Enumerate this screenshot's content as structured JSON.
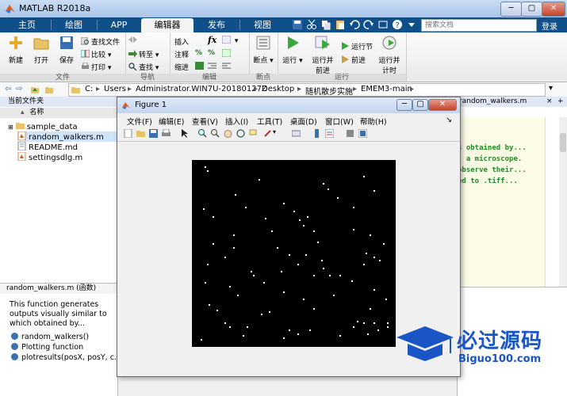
{
  "window": {
    "title": "MATLAB R2018a",
    "min": "─",
    "max": "▢",
    "close": "✕"
  },
  "tabs": [
    "主页",
    "绘图",
    "APP",
    "编辑器",
    "发布",
    "视图"
  ],
  "active_tab": "编辑器",
  "search_placeholder": "搜索文档",
  "login": "登录",
  "ribbon": {
    "file": {
      "label": "文件",
      "new": "新建",
      "open": "打开",
      "save": "保存",
      "find_files": "查找文件",
      "compare": "比较",
      "print": "打印"
    },
    "nav": {
      "label": "导航",
      "goto": "转至",
      "find": "查找"
    },
    "edit": {
      "label": "编辑",
      "insert": "插入",
      "comment": "注释",
      "indent": "缩进",
      "fx": "fx"
    },
    "breakpoints": {
      "label": "断点",
      "bp": "断点"
    },
    "run": {
      "label": "运行",
      "run": "运行",
      "run_advance_1": "运行并",
      "run_advance_2": "前进",
      "run_section": "运行节",
      "advance": "前进",
      "run_time_1": "运行并",
      "run_time_2": "计时"
    }
  },
  "address": [
    "C:",
    "Users",
    "Administrator.WIN7U-20180127Z",
    "Desktop",
    "随机散步实施",
    "EMEM3-main"
  ],
  "current_folder": {
    "title": "当前文件夹",
    "col_name": "名称",
    "items": [
      {
        "name": "sample_data",
        "type": "folder"
      },
      {
        "name": "random_walkers.m",
        "type": "mfile"
      },
      {
        "name": "README.md",
        "type": "file"
      },
      {
        "name": "settingsdlg.m",
        "type": "mfile"
      }
    ]
  },
  "details": {
    "header": "random_walkers.m  (函数)",
    "description": "This function generates outputs visually similar to which obtained by...",
    "functions": [
      "random_walkers()",
      "Plotting function",
      "plotresults(posX, posY, c..."
    ]
  },
  "editor": {
    "tab_title": "random_walkers.m",
    "lines": [
      "s obtained by...",
      ": a microscope.",
      "observe their...",
      "ed to .tiff..."
    ]
  },
  "figure": {
    "title": "Figure 1",
    "menus": [
      "文件(F)",
      "编辑(E)",
      "查看(V)",
      "插入(I)",
      "工具(T)",
      "桌面(D)",
      "窗口(W)",
      "帮助(H)"
    ]
  },
  "scatter": {
    "type": "scatter",
    "background": "#000000",
    "marker_color": "#ffffff",
    "points": [
      [
        0.06,
        0.97
      ],
      [
        0.07,
        0.95
      ],
      [
        0.21,
        0.82
      ],
      [
        0.33,
        0.9
      ],
      [
        0.65,
        0.88
      ],
      [
        0.67,
        0.85
      ],
      [
        0.85,
        0.92
      ],
      [
        0.9,
        0.84
      ],
      [
        0.72,
        0.8
      ],
      [
        0.8,
        0.75
      ],
      [
        0.05,
        0.74
      ],
      [
        0.1,
        0.7
      ],
      [
        0.26,
        0.75
      ],
      [
        0.45,
        0.77
      ],
      [
        0.5,
        0.73
      ],
      [
        0.36,
        0.69
      ],
      [
        0.55,
        0.65
      ],
      [
        0.6,
        0.62
      ],
      [
        0.57,
        0.7
      ],
      [
        0.53,
        0.68
      ],
      [
        0.39,
        0.62
      ],
      [
        0.2,
        0.6
      ],
      [
        0.8,
        0.63
      ],
      [
        0.1,
        0.55
      ],
      [
        0.2,
        0.53
      ],
      [
        0.88,
        0.6
      ],
      [
        0.95,
        0.55
      ],
      [
        0.9,
        0.48
      ],
      [
        0.86,
        0.5
      ],
      [
        0.93,
        0.46
      ],
      [
        0.85,
        0.44
      ],
      [
        0.16,
        0.48
      ],
      [
        0.07,
        0.44
      ],
      [
        0.29,
        0.4
      ],
      [
        0.35,
        0.34
      ],
      [
        0.52,
        0.44
      ],
      [
        0.44,
        0.4
      ],
      [
        0.56,
        0.49
      ],
      [
        0.48,
        0.49
      ],
      [
        0.3,
        0.38
      ],
      [
        0.6,
        0.38
      ],
      [
        0.64,
        0.46
      ],
      [
        0.65,
        0.42
      ],
      [
        0.73,
        0.38
      ],
      [
        0.79,
        0.35
      ],
      [
        0.9,
        0.3
      ],
      [
        0.96,
        0.25
      ],
      [
        0.06,
        0.34
      ],
      [
        0.18,
        0.32
      ],
      [
        0.22,
        0.27
      ],
      [
        0.45,
        0.29
      ],
      [
        0.55,
        0.25
      ],
      [
        0.6,
        0.2
      ],
      [
        0.38,
        0.18
      ],
      [
        0.34,
        0.17
      ],
      [
        0.7,
        0.27
      ],
      [
        0.88,
        0.2
      ],
      [
        0.9,
        0.12
      ],
      [
        0.82,
        0.13
      ],
      [
        0.8,
        0.1
      ],
      [
        0.97,
        0.12
      ],
      [
        0.27,
        0.1
      ],
      [
        0.16,
        0.12
      ],
      [
        0.18,
        0.1
      ],
      [
        0.25,
        0.05
      ],
      [
        0.04,
        0.03
      ],
      [
        0.48,
        0.08
      ],
      [
        0.58,
        0.08
      ],
      [
        0.52,
        0.06
      ],
      [
        0.73,
        0.05
      ],
      [
        0.87,
        0.06
      ],
      [
        0.92,
        0.08
      ],
      [
        0.97,
        0.1
      ],
      [
        0.85,
        0.12
      ],
      [
        0.68,
        0.38
      ],
      [
        0.42,
        0.53
      ],
      [
        0.62,
        0.56
      ],
      [
        0.08,
        0.22
      ],
      [
        0.12,
        0.19
      ],
      [
        0.45,
        0.04
      ]
    ]
  },
  "watermark": {
    "text": "必过源码",
    "url": "Biguo100.com"
  }
}
